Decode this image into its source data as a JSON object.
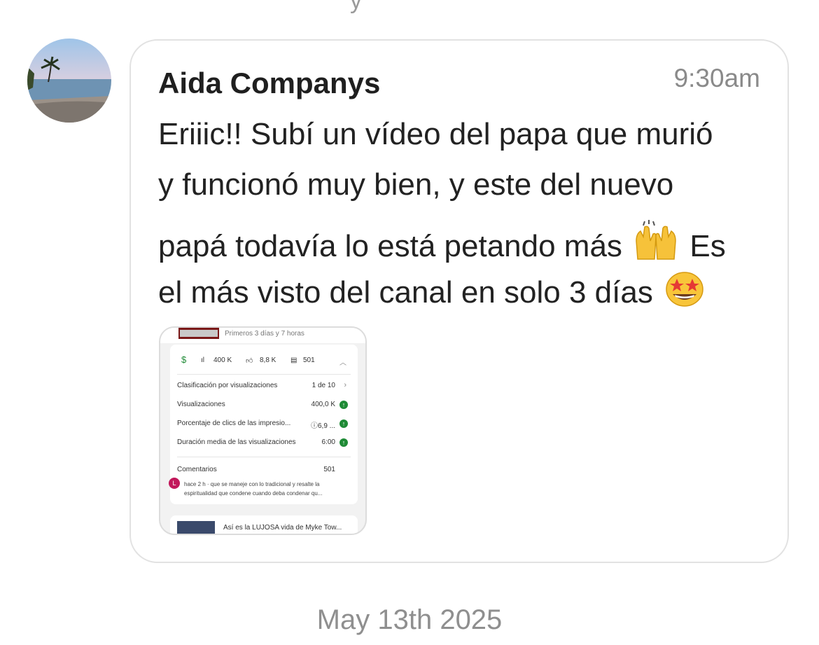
{
  "message": {
    "sender": "Aida Companys",
    "time": "9:30am",
    "lines": [
      "Eriiic!! Subí un vídeo del papa que murió",
      "y funcionó muy bien, y este del nuevo",
      "papá todavía lo está petando más",
      "Es",
      "el más visto del canal en solo 3 días"
    ],
    "emojis": [
      "raising-hands-emoji",
      "star-struck-emoji"
    ]
  },
  "attachment": {
    "period": "Primeros 3 días y 7 horas",
    "stats": {
      "views": "400 K",
      "likes": "8,8 K",
      "comments": "501"
    },
    "rows": [
      {
        "label": "Clasificación por visualizaciones",
        "value": "1 de 10"
      },
      {
        "label": "Visualizaciones",
        "value": "400,0 K"
      },
      {
        "label": "Porcentaje de clics de las impresio...",
        "value": "ⓘ6,9 ..."
      },
      {
        "label": "Duración media de las visualizaciones",
        "value": "6:00"
      }
    ],
    "comments_label": "Comentarios",
    "comments_count": "501",
    "comment_avatar": "L",
    "comment_line1": "hace 2 h · que se maneje con lo tradicional y resalte la",
    "comment_line2": "espiritualidad que condene cuando deba condenar qu...",
    "next_video_title": "Así es la LUJOSA vida de Myke Tow..."
  },
  "date_separator": "May 13th 2025",
  "colors": {
    "bubble_border": "#e2e2e2",
    "muted_text": "#8a8a8a",
    "up_green": "#1e8a35"
  }
}
